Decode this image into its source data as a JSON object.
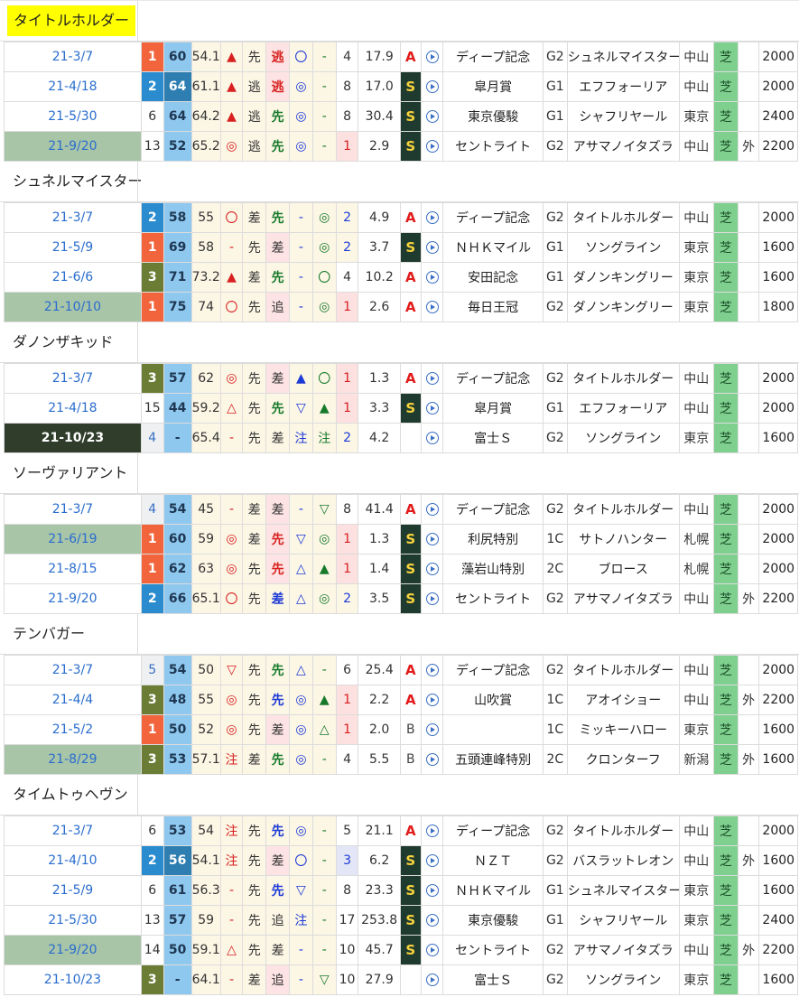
{
  "horses": [
    {
      "name": "タイトルホルダー",
      "highlight": true,
      "races": [
        {
          "date": "21-3/7",
          "date_style": "",
          "finish": "1",
          "finish_style": "f1",
          "speed": "60",
          "speed_dark": false,
          "weight": "54.1",
          "mark1": "▲",
          "mark1_color": "red",
          "style": "先",
          "pace": "逃",
          "pace_style": "pink",
          "m1": "〇",
          "m1_color": "blue",
          "m2": "-",
          "m2_color": "",
          "pop": "4",
          "pop_style": "",
          "odds": "17.9",
          "rank": "A",
          "race": "ディープ記念",
          "grade": "G2",
          "winner": "シュネルマイスター",
          "venue": "中山",
          "surface": "芝",
          "turn": "",
          "distance": "2000"
        },
        {
          "date": "21-4/18",
          "date_style": "",
          "finish": "2",
          "finish_style": "f2",
          "speed": "64",
          "speed_dark": true,
          "weight": "61.1",
          "mark1": "▲",
          "mark1_color": "red",
          "style": "逃",
          "pace": "逃",
          "pace_style": "pink",
          "m1": "◎",
          "m1_color": "blue",
          "m2": "-",
          "m2_color": "",
          "pop": "8",
          "pop_style": "",
          "odds": "17.0",
          "rank": "S",
          "race": "皐月賞",
          "grade": "G1",
          "winner": "エフフォーリア",
          "venue": "中山",
          "surface": "芝",
          "turn": "",
          "distance": "2000"
        },
        {
          "date": "21-5/30",
          "date_style": "",
          "finish": "6",
          "finish_style": "plain",
          "speed": "64",
          "speed_dark": false,
          "weight": "64.2",
          "mark1": "▲",
          "mark1_color": "red",
          "style": "逃",
          "pace": "先",
          "pace_style": "green",
          "m1": "◎",
          "m1_color": "blue",
          "m2": "-",
          "m2_color": "",
          "pop": "8",
          "pop_style": "",
          "odds": "30.4",
          "rank": "S",
          "race": "東京優駿",
          "grade": "G1",
          "winner": "シャフリヤール",
          "venue": "東京",
          "surface": "芝",
          "turn": "",
          "distance": "2400"
        },
        {
          "date": "21-9/20",
          "date_style": "mint",
          "finish": "13",
          "finish_style": "plain",
          "speed": "52",
          "speed_dark": false,
          "weight": "65.2",
          "mark1": "◎",
          "mark1_color": "red",
          "style": "逃",
          "pace": "先",
          "pace_style": "green",
          "m1": "◎",
          "m1_color": "blue",
          "m2": "-",
          "m2_color": "",
          "pop": "1",
          "pop_style": "p1",
          "odds": "2.9",
          "rank": "S",
          "race": "セントライト",
          "grade": "G2",
          "winner": "アサマノイタズラ",
          "venue": "中山",
          "surface": "芝",
          "turn": "外",
          "distance": "2200"
        }
      ]
    },
    {
      "name": "シュネルマイスター",
      "highlight": false,
      "races": [
        {
          "date": "21-3/7",
          "date_style": "",
          "finish": "2",
          "finish_style": "f2",
          "speed": "58",
          "speed_dark": false,
          "weight": "55",
          "mark1": "〇",
          "mark1_color": "red",
          "style": "差",
          "pace": "先",
          "pace_style": "green",
          "m1": "-",
          "m1_color": "blue",
          "m2": "◎",
          "m2_color": "green",
          "pop": "2",
          "pop_style": "p2",
          "odds": "4.9",
          "rank": "A",
          "race": "ディープ記念",
          "grade": "G2",
          "winner": "タイトルホルダー",
          "venue": "中山",
          "surface": "芝",
          "turn": "",
          "distance": "2000"
        },
        {
          "date": "21-5/9",
          "date_style": "",
          "finish": "1",
          "finish_style": "f1",
          "speed": "69",
          "speed_dark": false,
          "weight": "58",
          "mark1": "-",
          "mark1_color": "red",
          "style": "先",
          "pace": "差",
          "pace_style": "pink plain",
          "m1": "-",
          "m1_color": "blue",
          "m2": "◎",
          "m2_color": "green",
          "pop": "2",
          "pop_style": "p2",
          "odds": "3.7",
          "rank": "S",
          "race": "ＮＨＫマイル",
          "grade": "G1",
          "winner": "ソングライン",
          "venue": "東京",
          "surface": "芝",
          "turn": "",
          "distance": "1600"
        },
        {
          "date": "21-6/6",
          "date_style": "",
          "finish": "3",
          "finish_style": "f3",
          "speed": "71",
          "speed_dark": false,
          "weight": "73.2",
          "mark1": "▲",
          "mark1_color": "red",
          "style": "差",
          "pace": "先",
          "pace_style": "green",
          "m1": "-",
          "m1_color": "blue",
          "m2": "〇",
          "m2_color": "green",
          "pop": "4",
          "pop_style": "",
          "odds": "10.2",
          "rank": "A",
          "race": "安田記念",
          "grade": "G1",
          "winner": "ダノンキングリー",
          "venue": "東京",
          "surface": "芝",
          "turn": "",
          "distance": "1600"
        },
        {
          "date": "21-10/10",
          "date_style": "mint",
          "finish": "1",
          "finish_style": "f1",
          "speed": "75",
          "speed_dark": false,
          "weight": "74",
          "mark1": "〇",
          "mark1_color": "red",
          "style": "先",
          "pace": "追",
          "pace_style": "pink plain",
          "m1": "-",
          "m1_color": "blue",
          "m2": "◎",
          "m2_color": "green",
          "pop": "1",
          "pop_style": "p1",
          "odds": "2.6",
          "rank": "A",
          "race": "毎日王冠",
          "grade": "G2",
          "winner": "ダノンキングリー",
          "venue": "東京",
          "surface": "芝",
          "turn": "",
          "distance": "1800"
        }
      ]
    },
    {
      "name": "ダノンザキッド",
      "highlight": false,
      "races": [
        {
          "date": "21-3/7",
          "date_style": "",
          "finish": "3",
          "finish_style": "f3",
          "speed": "57",
          "speed_dark": false,
          "weight": "62",
          "mark1": "◎",
          "mark1_color": "red",
          "style": "先",
          "pace": "差",
          "pace_style": "pink plain",
          "m1": "▲",
          "m1_color": "blue",
          "m2": "〇",
          "m2_color": "green",
          "pop": "1",
          "pop_style": "p1",
          "odds": "1.3",
          "rank": "A",
          "race": "ディープ記念",
          "grade": "G2",
          "winner": "タイトルホルダー",
          "venue": "中山",
          "surface": "芝",
          "turn": "",
          "distance": "2000"
        },
        {
          "date": "21-4/18",
          "date_style": "",
          "finish": "15",
          "finish_style": "plain",
          "speed": "44",
          "speed_dark": false,
          "weight": "59.2",
          "mark1": "△",
          "mark1_color": "red",
          "style": "先",
          "pace": "先",
          "pace_style": "green",
          "m1": "▽",
          "m1_color": "blue",
          "m2": "▲",
          "m2_color": "green",
          "pop": "1",
          "pop_style": "p1",
          "odds": "3.3",
          "rank": "S",
          "race": "皐月賞",
          "grade": "G1",
          "winner": "エフフォーリア",
          "venue": "中山",
          "surface": "芝",
          "turn": "",
          "distance": "2000"
        },
        {
          "date": "21-10/23",
          "date_style": "dark",
          "finish": "4",
          "finish_style": "grey",
          "speed": "-",
          "speed_dark": false,
          "weight": "65.4",
          "mark1": "-",
          "mark1_color": "red",
          "style": "先",
          "pace": "差",
          "pace_style": "plain",
          "m1": "注",
          "m1_color": "blue",
          "m2": "注",
          "m2_color": "green",
          "pop": "2",
          "pop_style": "p2",
          "odds": "4.2",
          "rank": "",
          "race": "富士Ｓ",
          "grade": "G2",
          "winner": "ソングライン",
          "venue": "東京",
          "surface": "芝",
          "turn": "",
          "distance": "1600"
        }
      ]
    },
    {
      "name": "ソーヴァリアント",
      "highlight": false,
      "races": [
        {
          "date": "21-3/7",
          "date_style": "",
          "finish": "4",
          "finish_style": "grey",
          "speed": "54",
          "speed_dark": false,
          "weight": "45",
          "mark1": "-",
          "mark1_color": "red",
          "style": "差",
          "pace": "差",
          "pace_style": "pink plain",
          "m1": "-",
          "m1_color": "blue",
          "m2": "▽",
          "m2_color": "green",
          "pop": "8",
          "pop_style": "",
          "odds": "41.4",
          "rank": "A",
          "race": "ディープ記念",
          "grade": "G2",
          "winner": "タイトルホルダー",
          "venue": "中山",
          "surface": "芝",
          "turn": "",
          "distance": "2000"
        },
        {
          "date": "21-6/19",
          "date_style": "mint",
          "finish": "1",
          "finish_style": "f1",
          "speed": "60",
          "speed_dark": false,
          "weight": "59",
          "mark1": "◎",
          "mark1_color": "red",
          "style": "差",
          "pace": "先",
          "pace_style": "pink red",
          "m1": "▽",
          "m1_color": "blue",
          "m2": "◎",
          "m2_color": "green",
          "pop": "1",
          "pop_style": "p1",
          "odds": "1.3",
          "rank": "S",
          "race": "利尻特別",
          "grade": "1C",
          "winner": "サトノハンター",
          "venue": "札幌",
          "surface": "芝",
          "turn": "",
          "distance": "2000"
        },
        {
          "date": "21-8/15",
          "date_style": "",
          "finish": "1",
          "finish_style": "f1",
          "speed": "62",
          "speed_dark": false,
          "weight": "63",
          "mark1": "◎",
          "mark1_color": "red",
          "style": "先",
          "pace": "先",
          "pace_style": "pink red",
          "m1": "△",
          "m1_color": "blue",
          "m2": "▲",
          "m2_color": "green",
          "pop": "1",
          "pop_style": "p1",
          "odds": "1.4",
          "rank": "S",
          "race": "藻岩山特別",
          "grade": "2C",
          "winner": "ブロース",
          "venue": "札幌",
          "surface": "芝",
          "turn": "",
          "distance": "2000"
        },
        {
          "date": "21-9/20",
          "date_style": "",
          "finish": "2",
          "finish_style": "f2",
          "speed": "66",
          "speed_dark": false,
          "weight": "65.1",
          "mark1": "〇",
          "mark1_color": "red",
          "style": "先",
          "pace": "差",
          "pace_style": "blue",
          "m1": "△",
          "m1_color": "blue",
          "m2": "◎",
          "m2_color": "green",
          "pop": "2",
          "pop_style": "p2",
          "odds": "3.5",
          "rank": "S",
          "race": "セントライト",
          "grade": "G2",
          "winner": "アサマノイタズラ",
          "venue": "中山",
          "surface": "芝",
          "turn": "外",
          "distance": "2200"
        }
      ]
    },
    {
      "name": "テンバガー",
      "highlight": false,
      "races": [
        {
          "date": "21-3/7",
          "date_style": "",
          "finish": "5",
          "finish_style": "grey",
          "speed": "54",
          "speed_dark": false,
          "weight": "50",
          "mark1": "▽",
          "mark1_color": "red",
          "style": "先",
          "pace": "先",
          "pace_style": "green",
          "m1": "△",
          "m1_color": "blue",
          "m2": "-",
          "m2_color": "green",
          "pop": "6",
          "pop_style": "",
          "odds": "25.4",
          "rank": "A",
          "race": "ディープ記念",
          "grade": "G2",
          "winner": "タイトルホルダー",
          "venue": "中山",
          "surface": "芝",
          "turn": "",
          "distance": "2000"
        },
        {
          "date": "21-4/4",
          "date_style": "",
          "finish": "3",
          "finish_style": "f3",
          "speed": "48",
          "speed_dark": false,
          "weight": "55",
          "mark1": "◎",
          "mark1_color": "red",
          "style": "先",
          "pace": "先",
          "pace_style": "blue",
          "m1": "◎",
          "m1_color": "blue",
          "m2": "▲",
          "m2_color": "green",
          "pop": "1",
          "pop_style": "p1",
          "odds": "2.2",
          "rank": "A",
          "race": "山吹賞",
          "grade": "1C",
          "winner": "アオイショー",
          "venue": "中山",
          "surface": "芝",
          "turn": "外",
          "distance": "2200"
        },
        {
          "date": "21-5/2",
          "date_style": "",
          "finish": "1",
          "finish_style": "f1",
          "speed": "50",
          "speed_dark": false,
          "weight": "52",
          "mark1": "◎",
          "mark1_color": "red",
          "style": "先",
          "pace": "差",
          "pace_style": "pink plain",
          "m1": "◎",
          "m1_color": "blue",
          "m2": "△",
          "m2_color": "green",
          "pop": "1",
          "pop_style": "p1",
          "odds": "2.0",
          "rank": "B",
          "race": "",
          "grade": "1C",
          "winner": "ミッキーハロー",
          "venue": "東京",
          "surface": "芝",
          "turn": "",
          "distance": "1600"
        },
        {
          "date": "21-8/29",
          "date_style": "mint",
          "finish": "3",
          "finish_style": "f3",
          "speed": "53",
          "speed_dark": false,
          "weight": "57.1",
          "mark1": "注",
          "mark1_color": "red",
          "style": "差",
          "pace": "先",
          "pace_style": "green",
          "m1": "◎",
          "m1_color": "blue",
          "m2": "-",
          "m2_color": "green",
          "pop": "4",
          "pop_style": "",
          "odds": "5.5",
          "rank": "B",
          "race": "五頭連峰特別",
          "grade": "2C",
          "winner": "クロンターフ",
          "venue": "新潟",
          "surface": "芝",
          "turn": "外",
          "distance": "1600"
        }
      ]
    },
    {
      "name": "タイムトゥヘヴン",
      "highlight": false,
      "races": [
        {
          "date": "21-3/7",
          "date_style": "",
          "finish": "6",
          "finish_style": "plain",
          "speed": "53",
          "speed_dark": false,
          "weight": "54",
          "mark1": "注",
          "mark1_color": "red",
          "style": "先",
          "pace": "先",
          "pace_style": "blue",
          "m1": "◎",
          "m1_color": "blue",
          "m2": "-",
          "m2_color": "green",
          "pop": "5",
          "pop_style": "",
          "odds": "21.1",
          "rank": "A",
          "race": "ディープ記念",
          "grade": "G2",
          "winner": "タイトルホルダー",
          "venue": "中山",
          "surface": "芝",
          "turn": "",
          "distance": "2000"
        },
        {
          "date": "21-4/10",
          "date_style": "",
          "finish": "2",
          "finish_style": "f2",
          "speed": "56",
          "speed_dark": true,
          "weight": "54.1",
          "mark1": "注",
          "mark1_color": "red",
          "style": "先",
          "pace": "差",
          "pace_style": "pink plain",
          "m1": "〇",
          "m1_color": "blue",
          "m2": "-",
          "m2_color": "green",
          "pop": "3",
          "pop_style": "p3",
          "odds": "6.2",
          "rank": "S",
          "race": "ＮＺＴ",
          "grade": "G2",
          "winner": "バスラットレオン",
          "venue": "中山",
          "surface": "芝",
          "turn": "外",
          "distance": "1600"
        },
        {
          "date": "21-5/9",
          "date_style": "",
          "finish": "6",
          "finish_style": "plain",
          "speed": "61",
          "speed_dark": false,
          "weight": "56.3",
          "mark1": "-",
          "mark1_color": "red",
          "style": "先",
          "pace": "先",
          "pace_style": "blue",
          "m1": "▽",
          "m1_color": "blue",
          "m2": "-",
          "m2_color": "green",
          "pop": "8",
          "pop_style": "",
          "odds": "23.3",
          "rank": "S",
          "race": "ＮＨＫマイル",
          "grade": "G1",
          "winner": "シュネルマイスター",
          "venue": "東京",
          "surface": "芝",
          "turn": "",
          "distance": "1600"
        },
        {
          "date": "21-5/30",
          "date_style": "",
          "finish": "13",
          "finish_style": "plain",
          "speed": "57",
          "speed_dark": false,
          "weight": "59",
          "mark1": "-",
          "mark1_color": "red",
          "style": "先",
          "pace": "追",
          "pace_style": "plain",
          "m1": "注",
          "m1_color": "blue",
          "m2": "-",
          "m2_color": "green",
          "pop": "17",
          "pop_style": "",
          "odds": "253.8",
          "rank": "S",
          "race": "東京優駿",
          "grade": "G1",
          "winner": "シャフリヤール",
          "venue": "東京",
          "surface": "芝",
          "turn": "",
          "distance": "2400"
        },
        {
          "date": "21-9/20",
          "date_style": "mint",
          "finish": "14",
          "finish_style": "plain",
          "speed": "50",
          "speed_dark": false,
          "weight": "59.1",
          "mark1": "△",
          "mark1_color": "red",
          "style": "先",
          "pace": "差",
          "pace_style": "plain",
          "m1": "-",
          "m1_color": "blue",
          "m2": "-",
          "m2_color": "green",
          "pop": "10",
          "pop_style": "",
          "odds": "45.7",
          "rank": "S",
          "race": "セントライト",
          "grade": "G2",
          "winner": "アサマノイタズラ",
          "venue": "中山",
          "surface": "芝",
          "turn": "外",
          "distance": "2200"
        },
        {
          "date": "21-10/23",
          "date_style": "",
          "finish": "3",
          "finish_style": "f3",
          "speed": "-",
          "speed_dark": false,
          "weight": "64.1",
          "mark1": "-",
          "mark1_color": "red",
          "style": "差",
          "pace": "追",
          "pace_style": "pink plain",
          "m1": "-",
          "m1_color": "blue",
          "m2": "▽",
          "m2_color": "green",
          "pop": "10",
          "pop_style": "",
          "odds": "27.9",
          "rank": "",
          "race": "富士Ｓ",
          "grade": "G2",
          "winner": "ソングライン",
          "venue": "東京",
          "surface": "芝",
          "turn": "",
          "distance": "1600"
        }
      ]
    }
  ],
  "colors": {
    "title_highlight": "#ffff00",
    "finish_1": "#f2643b",
    "finish_2": "#2a8ccf",
    "finish_3": "#6b7d35",
    "speed_index": "#8fc8ef",
    "rank_S_bg": "#1f3a2e",
    "turf": "#7fcf8f",
    "date_link": "#2a6dce"
  },
  "icons": {
    "video": "play-circle-icon"
  }
}
